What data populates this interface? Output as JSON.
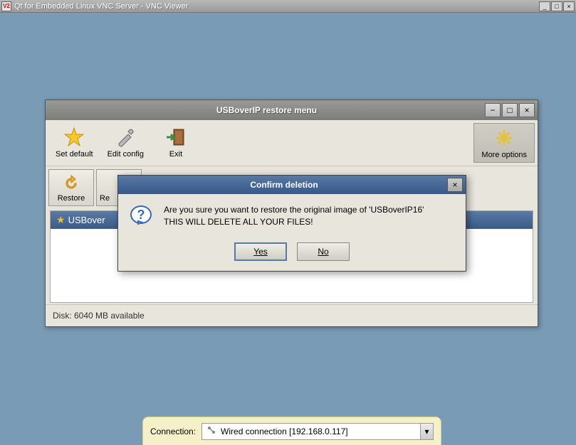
{
  "vnc": {
    "title": "Qt for Embedded Linux VNC Server - VNC Viewer",
    "logo": "V2"
  },
  "app": {
    "title": "USBoverIP restore menu",
    "toolbar": {
      "set_default": "Set default",
      "edit_config": "Edit config",
      "exit": "Exit",
      "more_options": "More options"
    },
    "toolbar2": {
      "restore": "Restore",
      "second": "Re"
    },
    "list": {
      "header": "USBover"
    },
    "status": "Disk: 6040 MB available"
  },
  "dialog": {
    "title": "Confirm deletion",
    "line1": "Are you sure you want to restore the original image of 'USBoverIP16'",
    "line2": "THIS WILL DELETE ALL YOUR FILES!",
    "yes": "Yes",
    "no": "No"
  },
  "connection": {
    "label": "Connection:",
    "value": "Wired connection [192.168.0.117]"
  }
}
